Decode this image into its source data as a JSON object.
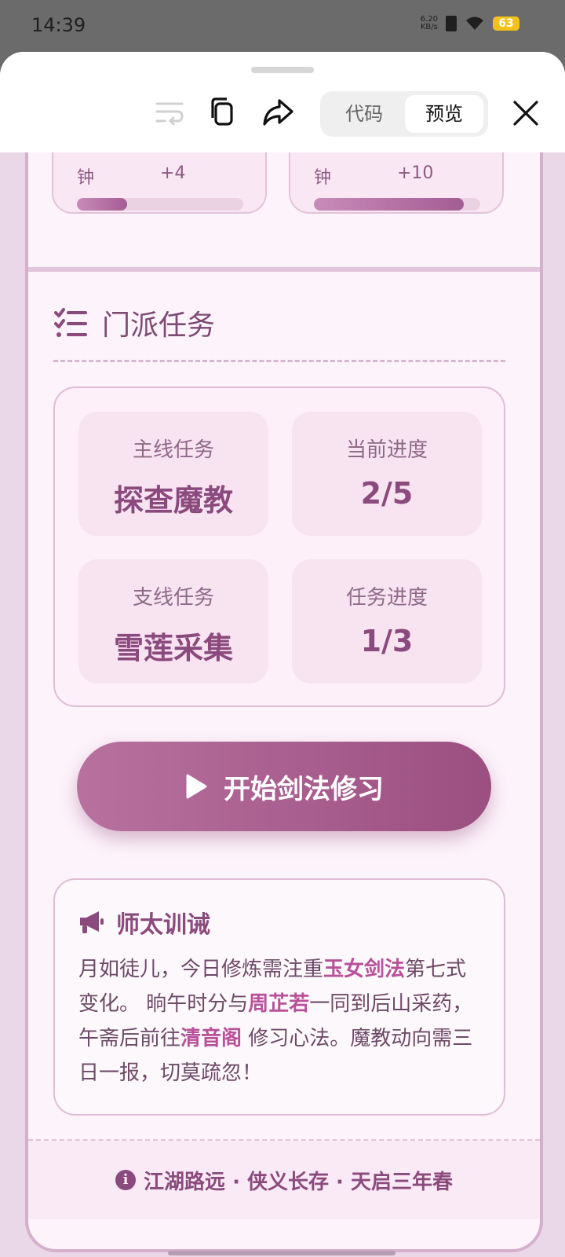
{
  "status": {
    "time": "14:39",
    "net_speed_value": "6.20",
    "net_speed_unit": "KB/s",
    "battery": "63"
  },
  "toolbar": {
    "tab_code": "代码",
    "tab_preview": "预览",
    "active_tab": "预览"
  },
  "stats": [
    {
      "label": "钟",
      "delta": "+4",
      "progress": 0.3
    },
    {
      "label": "钟",
      "delta": "+10",
      "progress": 0.9
    }
  ],
  "section": {
    "title": "门派任务"
  },
  "tasks": [
    {
      "label": "主线任务",
      "value": "探查魔教"
    },
    {
      "label": "当前进度",
      "value": "2/5"
    },
    {
      "label": "支线任务",
      "value": "雪莲采集"
    },
    {
      "label": "任务进度",
      "value": "1/3"
    }
  ],
  "start_button": {
    "label": "开始剑法修习"
  },
  "notice": {
    "title": "师太训诫",
    "p1": "月如徒儿，今日修炼需注重",
    "h1": "玉女剑法",
    "p2": "第七式变化。 晌午时分与",
    "h2": "周芷若",
    "p3": "一同到后山采药，午斋后前往",
    "h3": "清音阁",
    "p4": " 修习心法。魔教动向需三日一报，切莫疏忽！"
  },
  "footer": {
    "text": "江湖路远 · 侠义长存 · 天启三年春"
  },
  "colors": {
    "accent": "#8b4a7e",
    "highlight": "#b8509a",
    "frame_border": "#d5b0cc"
  }
}
